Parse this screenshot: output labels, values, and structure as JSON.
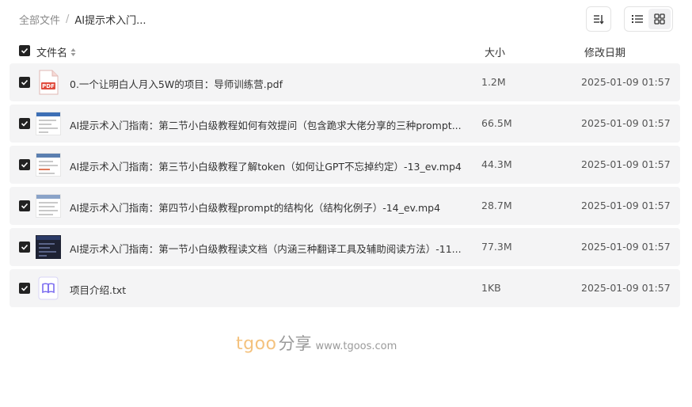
{
  "breadcrumb": {
    "root": "全部文件",
    "separator": "/",
    "current": "AI提示术入门..."
  },
  "toolbar": {
    "sort_icon": "sort-icon",
    "list_view_icon": "list-view-icon",
    "grid_view_icon": "grid-view-icon"
  },
  "table": {
    "headers": {
      "name": "文件名",
      "size": "大小",
      "date": "修改日期"
    },
    "rows": [
      {
        "name": "0.一个让明白人月入5W的项目：导师训练营.pdf",
        "size": "1.2M",
        "date": "2025-01-09 01:57",
        "icon": "pdf-icon",
        "checked": true
      },
      {
        "name": "AI提示术入门指南：第二节小白级教程如何有效提问（包含跪求大佬分享的三种prompt...",
        "size": "66.5M",
        "date": "2025-01-09 01:57",
        "icon": "video-thumbnail",
        "checked": true
      },
      {
        "name": "AI提示术入门指南：第三节小白级教程了解token（如何让GPT不忘掉约定）-13_ev.mp4",
        "size": "44.3M",
        "date": "2025-01-09 01:57",
        "icon": "video-thumbnail",
        "checked": true
      },
      {
        "name": "AI提示术入门指南：第四节小白级教程prompt的结构化（结构化例子）-14_ev.mp4",
        "size": "28.7M",
        "date": "2025-01-09 01:57",
        "icon": "video-thumbnail",
        "checked": true
      },
      {
        "name": "AI提示术入门指南：第一节小白级教程读文档（内涵三种翻译工具及辅助阅读方法）-11...",
        "size": "77.3M",
        "date": "2025-01-09 01:57",
        "icon": "video-thumbnail",
        "checked": true
      },
      {
        "name": "项目介绍.txt",
        "size": "1KB",
        "date": "2025-01-09 01:57",
        "icon": "txt-book-icon",
        "checked": true
      }
    ]
  },
  "watermark": {
    "brand": "tgoo",
    "share": "分享",
    "url": "www.tgoos.com"
  },
  "colors": {
    "checkbox": "#222222",
    "row_bg": "#f4f4f5",
    "pdf_red": "#e04b3c",
    "txt_purple": "#7b6cf0",
    "watermark_orange": "#f4c27e"
  }
}
